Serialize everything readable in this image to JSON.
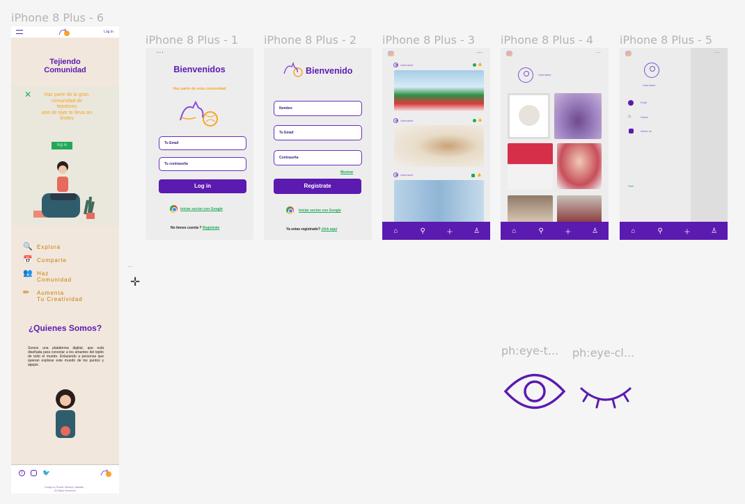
{
  "frames": {
    "f6": "iPhone 8 Plus - 6",
    "f1": "iPhone 8 Plus - 1",
    "f2": "iPhone 8 Plus - 2",
    "f3": "iPhone 8 Plus - 3",
    "f4": "iPhone 8 Plus - 4",
    "f5": "iPhone 8 Plus - 5"
  },
  "icons": {
    "eye_label": "ph:eye-t...",
    "eyeclosed_label": "ph:eye-cl...",
    "eye": "eye-icon",
    "eye_closed": "eye-closed-icon",
    "colors": {
      "purple": "#5b1ab0",
      "green": "#21a85a",
      "orange": "#f5a623"
    }
  },
  "landing": {
    "login_link": "Log In",
    "title_line1": "Tejiendo",
    "title_line2": "Comunidad",
    "tagline1": "Haz parte de la gran,",
    "tagline2": "comunidad de",
    "tagline3": "tejedores",
    "tagline4": "arte de tejer te lleva sin",
    "tagline5": "limites",
    "login_btn": "log in",
    "features": [
      {
        "l1": "Explora",
        "l2": ""
      },
      {
        "l1": "Comparte",
        "l2": ""
      },
      {
        "l1": "Haz",
        "l2": "Comunidad"
      },
      {
        "l1": "Aumenta",
        "l2": "Tu Creatividad"
      }
    ],
    "about_title": "¿Quienes Somos?",
    "about_text": "Somos una plataforma digitial, que está diseñada para conectar a los amantes del tejido de todo el mundo. Enlazando a personas que quieran explorar este mundo de los puntos y agujas.",
    "credits1": "Design by Ruslaf, Stefanyt, Nataliat, -",
    "credits2": "All Rights Reserved"
  },
  "login": {
    "title": "Bienvenidos",
    "subtitle": "Haz parte de esta comunidad",
    "email_ph": "Tu Email",
    "pass_ph": "Tu contraseña",
    "btn": "Log in",
    "google": "iniciar secion con Google",
    "no_account": "No tienes cuenta ?",
    "register_link": "Registrate"
  },
  "register": {
    "title": "Bienvenido",
    "name_ph": "Nombre",
    "email_ph": "Tu Email",
    "pass_ph": "Contraseña",
    "show": "Mostrar",
    "btn": "Registrate",
    "google": "iniciar secion con Google",
    "have_account": "Ya estas registrado?",
    "click": "click aqui"
  },
  "feed": {
    "username": "Username"
  },
  "profile": {
    "username": "Username"
  },
  "menu": {
    "username": "Username",
    "items": [
      "Perfil",
      "Home",
      "About us"
    ],
    "logout": "Salir"
  }
}
